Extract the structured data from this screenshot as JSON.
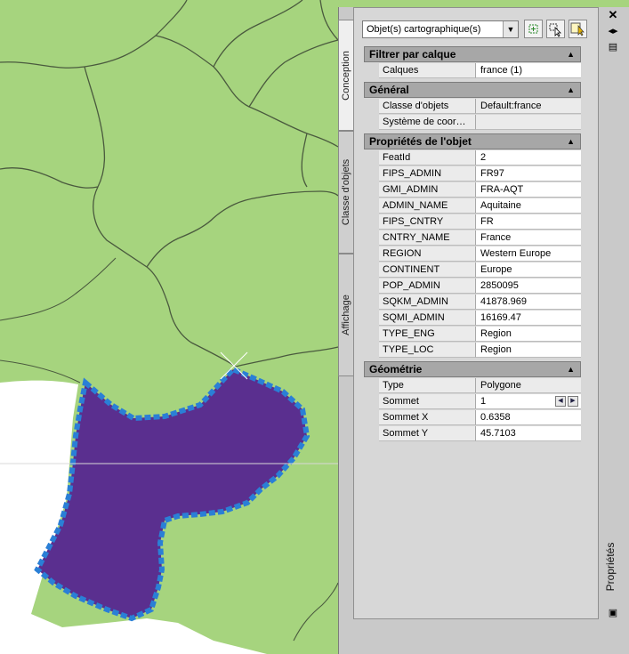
{
  "panel": {
    "title": "Propriétés",
    "tabs": [
      {
        "label": "Conception",
        "active": true
      },
      {
        "label": "Classe d'objets",
        "active": false
      },
      {
        "label": "Affichage",
        "active": false
      }
    ],
    "object_selector": {
      "value": "Objet(s) cartographique(s)"
    }
  },
  "sections": {
    "filter": {
      "title": "Filtrer par calque",
      "rows": [
        {
          "key": "Calques",
          "value": "france (1)"
        }
      ]
    },
    "general": {
      "title": "Général",
      "rows": [
        {
          "key": "Classe d'objets",
          "value": "Default:france"
        },
        {
          "key": "Système de coor…",
          "value": ""
        }
      ]
    },
    "props": {
      "title": "Propriétés de l'objet",
      "rows": [
        {
          "key": "FeatId",
          "value": "2"
        },
        {
          "key": "FIPS_ADMIN",
          "value": "FR97"
        },
        {
          "key": "GMI_ADMIN",
          "value": "FRA-AQT"
        },
        {
          "key": "ADMIN_NAME",
          "value": "Aquitaine"
        },
        {
          "key": "FIPS_CNTRY",
          "value": "FR"
        },
        {
          "key": "CNTRY_NAME",
          "value": "France"
        },
        {
          "key": "REGION",
          "value": "Western Europe"
        },
        {
          "key": "CONTINENT",
          "value": "Europe"
        },
        {
          "key": "POP_ADMIN",
          "value": "2850095"
        },
        {
          "key": "SQKM_ADMIN",
          "value": "41878.969"
        },
        {
          "key": "SQMI_ADMIN",
          "value": "16169.47"
        },
        {
          "key": "TYPE_ENG",
          "value": "Region"
        },
        {
          "key": "TYPE_LOC",
          "value": "Region"
        }
      ]
    },
    "geometry": {
      "title": "Géométrie",
      "rows": [
        {
          "key": "Type",
          "value": "Polygone"
        },
        {
          "key": "Sommet",
          "value": "1"
        },
        {
          "key": "Sommet X",
          "value": "0.6358"
        },
        {
          "key": "Sommet Y",
          "value": "45.7103"
        }
      ]
    }
  },
  "colors": {
    "land": "#a6d47e",
    "borders": "#4a5a3e",
    "selected_fill": "#5a2f8f",
    "grip": "#2a7fd6"
  }
}
